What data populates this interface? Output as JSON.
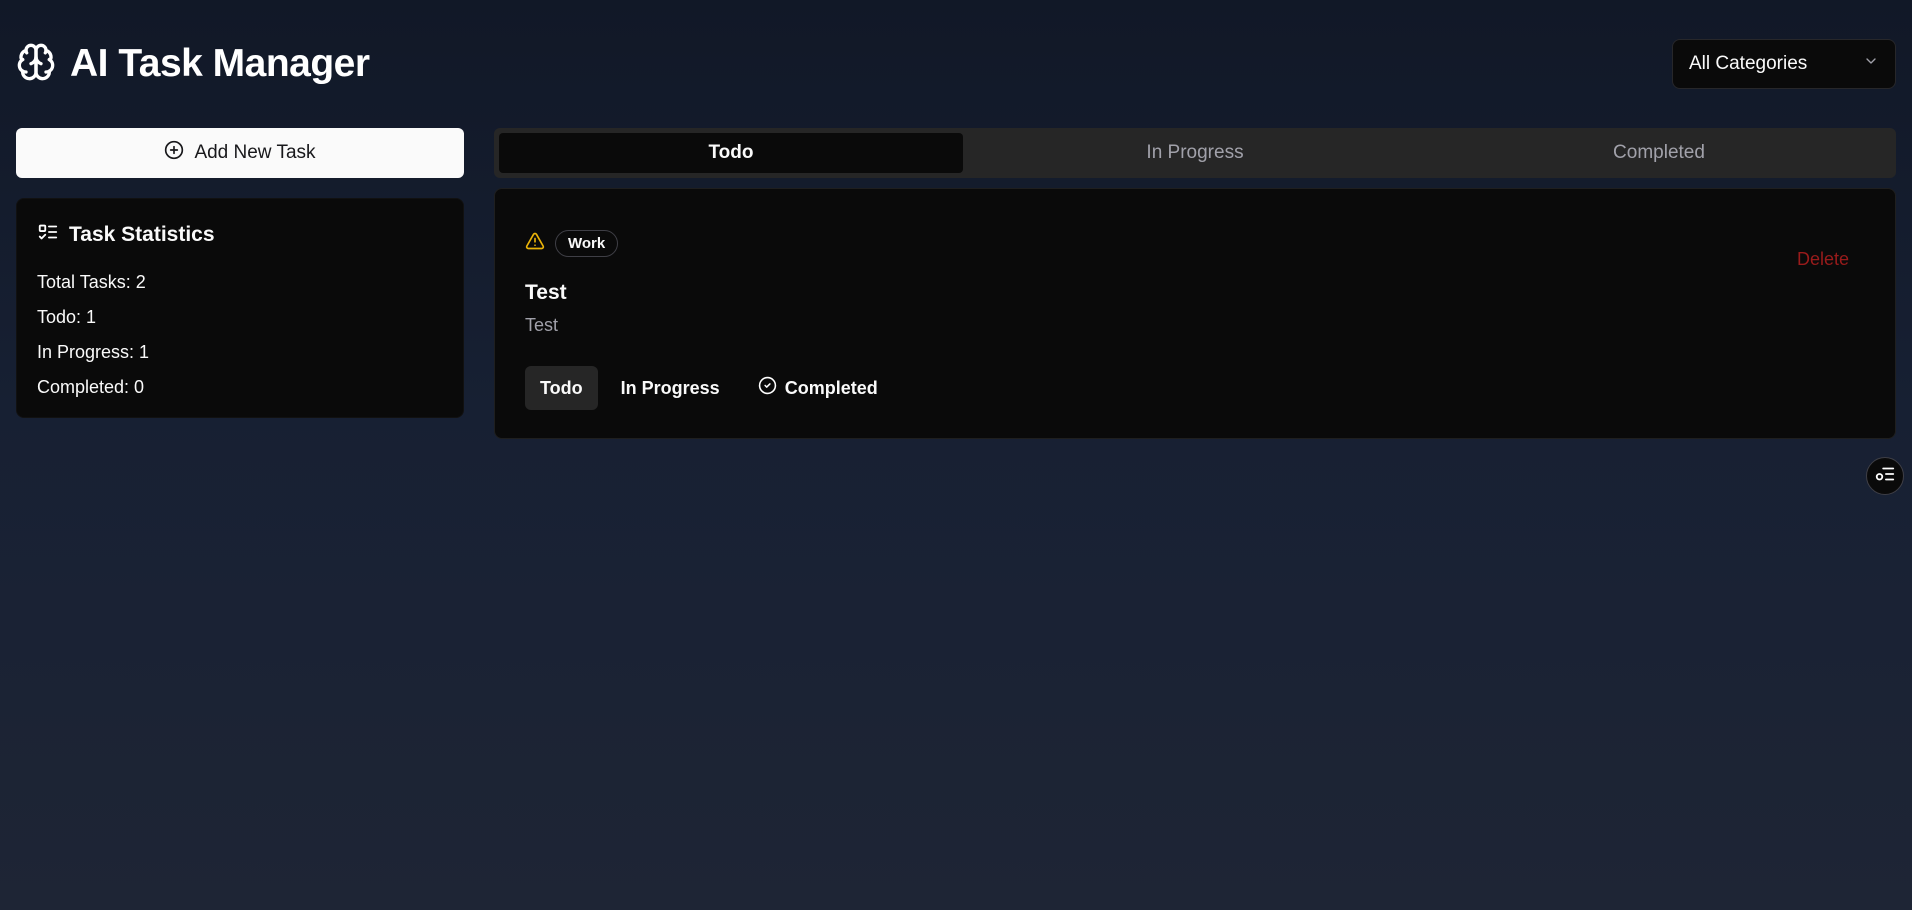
{
  "app": {
    "title": "AI Task Manager"
  },
  "category_select": {
    "value": "All Categories"
  },
  "sidebar": {
    "add_task_label": "Add New Task",
    "stats": {
      "title": "Task Statistics",
      "lines": [
        "Total Tasks: 2",
        "Todo: 1",
        "In Progress: 1",
        "Completed: 0"
      ]
    }
  },
  "tabs": [
    {
      "label": "Todo",
      "active": true
    },
    {
      "label": "In Progress",
      "active": false
    },
    {
      "label": "Completed",
      "active": false
    }
  ],
  "task": {
    "priority_icon": "alert-triangle-icon",
    "category": "Work",
    "delete_label": "Delete",
    "title": "Test",
    "description": "Test",
    "status_buttons": [
      "Todo",
      "In Progress",
      "Completed"
    ]
  },
  "colors": {
    "delete": "#991b1b",
    "priority_warning": "#eab308"
  }
}
